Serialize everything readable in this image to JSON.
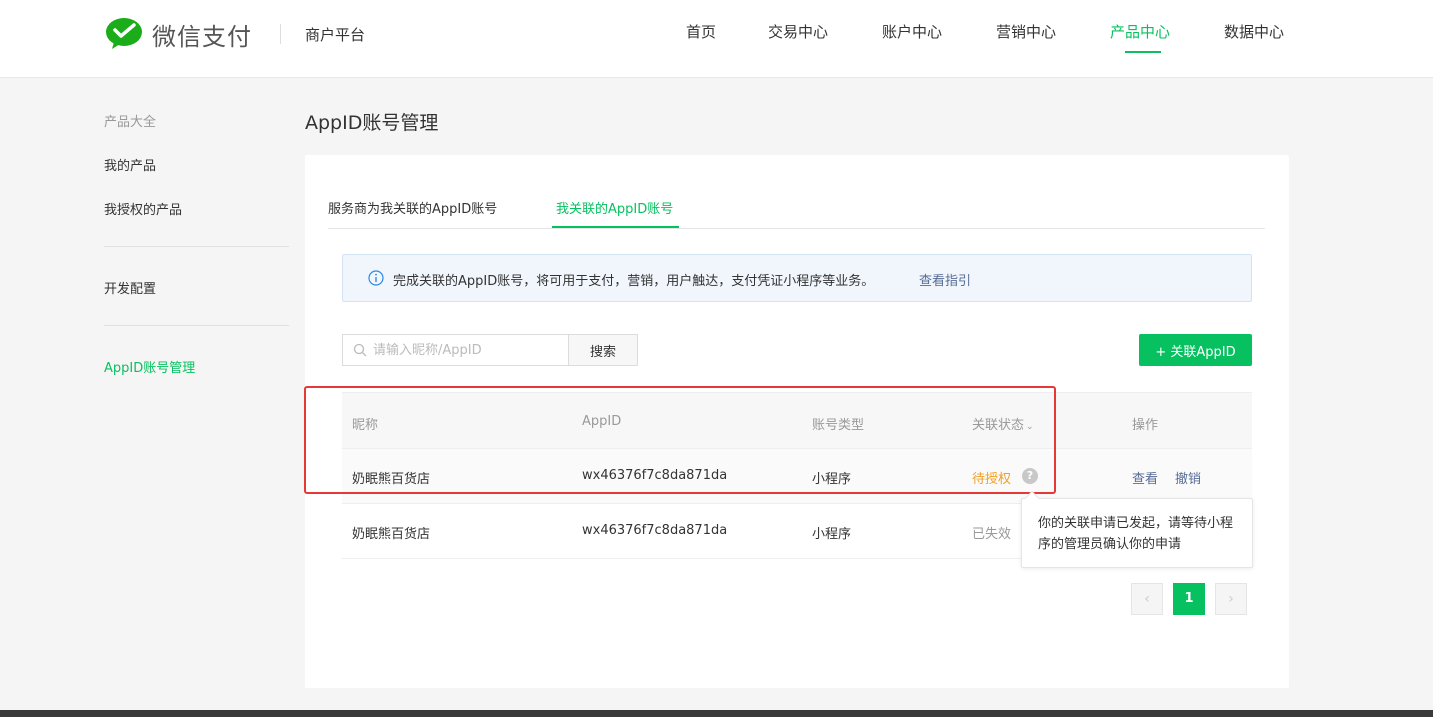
{
  "header": {
    "logo_text": "微信支付",
    "platform": "商户平台",
    "nav": [
      {
        "label": "首页"
      },
      {
        "label": "交易中心"
      },
      {
        "label": "账户中心"
      },
      {
        "label": "营销中心"
      },
      {
        "label": "产品中心"
      },
      {
        "label": "数据中心"
      }
    ],
    "active_nav": "产品中心"
  },
  "sidebar": {
    "title": "产品大全",
    "items": [
      {
        "label": "我的产品"
      },
      {
        "label": "我授权的产品"
      },
      {
        "label": "开发配置"
      },
      {
        "label": "AppID账号管理"
      }
    ]
  },
  "main": {
    "page_title": "AppID账号管理",
    "tabs": [
      {
        "label": "服务商为我关联的AppID账号"
      },
      {
        "label": "我关联的AppID账号"
      }
    ],
    "notice": {
      "text": "完成关联的AppID账号，将可用于支付，营销，用户触达，支付凭证小程序等业务。",
      "link": "查看指引"
    },
    "search": {
      "placeholder": "请输入昵称/AppID",
      "button": "搜索"
    },
    "add_button": "+ 关联AppID",
    "table": {
      "headers": [
        "昵称",
        "AppID",
        "账号类型",
        "关联状态",
        "操作"
      ],
      "rows": [
        {
          "nickname": "奶眠熊百货店",
          "appid": "wx46376f7c8da871da",
          "type": "小程序",
          "status": "待授权",
          "help": "?",
          "actions": [
            "查看",
            "撤销"
          ]
        },
        {
          "nickname": "奶眠熊百货店",
          "appid": "wx46376f7c8da871da",
          "type": "小程序",
          "status": "已失效",
          "actions": []
        }
      ]
    },
    "tooltip": "你的关联申请已发起，请等待小程序的管理员确认你的申请",
    "pagination": {
      "prev": "‹",
      "current": "1",
      "next": "›"
    }
  },
  "colors": {
    "accent": "#07c160",
    "pending": "#f0a028",
    "link": "#576b95",
    "highlight": "#e53935"
  }
}
